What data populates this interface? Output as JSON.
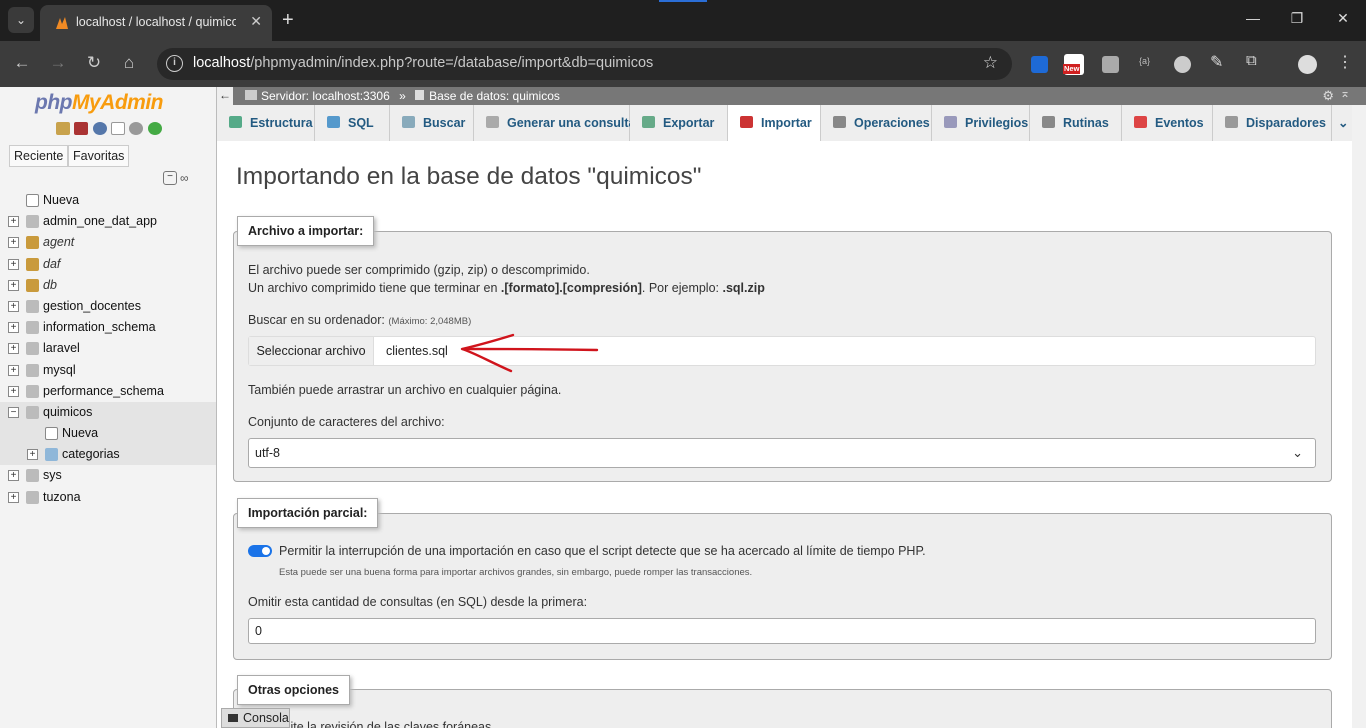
{
  "browser": {
    "tab_title": "localhost / localhost / quimicos",
    "url_host": "localhost",
    "url_path": "/phpmyadmin/index.php?route=/database/import&db=quimicos",
    "ext_new_badge": "New"
  },
  "sidebar": {
    "logo_php": "php",
    "logo_myadmin": "MyAdmin",
    "recent_label": "Reciente",
    "favorites_label": "Favoritas",
    "tree": [
      {
        "label": "Nueva",
        "type": "new",
        "level": 0
      },
      {
        "label": "admin_one_dat_app",
        "type": "db",
        "level": 0
      },
      {
        "label": "agent",
        "type": "db-italic",
        "level": 0
      },
      {
        "label": "daf",
        "type": "db-italic",
        "level": 0
      },
      {
        "label": "db",
        "type": "db-italic",
        "level": 0
      },
      {
        "label": "gestion_docentes",
        "type": "db",
        "level": 0
      },
      {
        "label": "information_schema",
        "type": "db",
        "level": 0
      },
      {
        "label": "laravel",
        "type": "db",
        "level": 0
      },
      {
        "label": "mysql",
        "type": "db",
        "level": 0
      },
      {
        "label": "performance_schema",
        "type": "db",
        "level": 0
      },
      {
        "label": "quimicos",
        "type": "db-open",
        "level": 0
      },
      {
        "label": "Nueva",
        "type": "new",
        "level": 1
      },
      {
        "label": "categorias",
        "type": "table",
        "level": 1
      },
      {
        "label": "sys",
        "type": "db",
        "level": 0
      },
      {
        "label": "tuzona",
        "type": "db",
        "level": 0
      }
    ]
  },
  "breadcrumb": {
    "server": "Servidor: localhost:3306",
    "sep": "»",
    "database": "Base de datos: quimicos"
  },
  "tabs": [
    {
      "label": "Estructura"
    },
    {
      "label": "SQL"
    },
    {
      "label": "Buscar"
    },
    {
      "label": "Generar una consulta"
    },
    {
      "label": "Exportar"
    },
    {
      "label": "Importar"
    },
    {
      "label": "Operaciones"
    },
    {
      "label": "Privilegios"
    },
    {
      "label": "Rutinas"
    },
    {
      "label": "Eventos"
    },
    {
      "label": "Disparadores"
    }
  ],
  "page": {
    "title": "Importando en la base de datos \"quimicos\""
  },
  "file_section": {
    "legend": "Archivo a importar:",
    "line1": "El archivo puede ser comprimido (gzip, zip) o descomprimido.",
    "line2_prefix": "Un archivo comprimido tiene que terminar en ",
    "line2_bold": ".[formato].[compresión]",
    "line2_mid": ". Por ejemplo: ",
    "line2_example": ".sql.zip",
    "browse_label": "Buscar en su ordenador:",
    "max_size": "(Máximo: 2,048MB)",
    "choose_button": "Seleccionar archivo",
    "file_name": "clientes.sql",
    "drag_hint": "También puede arrastrar un archivo en cualquier página.",
    "charset_label": "Conjunto de caracteres del archivo:",
    "charset_value": "utf-8"
  },
  "partial_section": {
    "legend": "Importación parcial:",
    "allow_interrupt_label": "Permitir la interrupción de una importación en caso que el script detecte que se ha acercado al límite de tiempo PHP.",
    "allow_interrupt_enabled": true,
    "allow_interrupt_hint": "Esta puede ser una buena forma para importar archivos grandes, sin embargo, puede romper las transacciones.",
    "skip_label": "Omitir esta cantidad de consultas (en SQL) desde la primera:",
    "skip_value": "0"
  },
  "other_section": {
    "legend": "Otras opciones",
    "partial_text": "abilite la revisión de las claves foráneas"
  },
  "console_label": "Consola",
  "colors": {
    "annotation_red": "#d0141c",
    "link_blue": "#235a81",
    "toggle_blue": "#1a73e8"
  }
}
